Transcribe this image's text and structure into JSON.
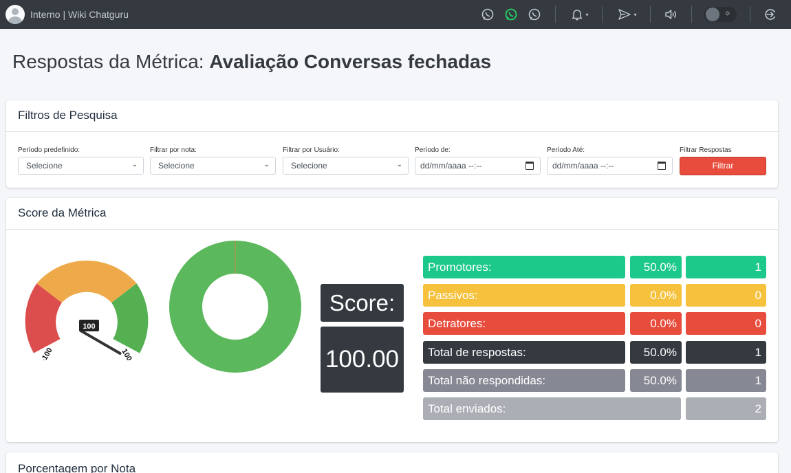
{
  "topbar": {
    "brand": "Interno | Wiki Chatguru",
    "icons": [
      "whatsapp-icon",
      "whatsapp-active-icon",
      "whatsapp-icon",
      "bell-icon",
      "send-icon",
      "volume-icon",
      "theme-toggle",
      "logout-icon"
    ],
    "caret": "▾",
    "sun": "☼"
  },
  "title": {
    "prefix": "Respostas da Métrica: ",
    "name": "Avaliação Conversas fechadas"
  },
  "filters": {
    "header": "Filtros de Pesquisa",
    "periodo_label": "Período predefinido:",
    "periodo_value": "Selecione",
    "nota_label": "Filtrar por nota:",
    "nota_value": "Selecione",
    "usuario_label": "Filtrar por Usuário:",
    "usuario_value": "Selecione",
    "de_label": "Período de:",
    "de_value": "dd/mm/aaaa --:--",
    "ate_label": "Período Até:",
    "ate_value": "dd/mm/aaaa --:--",
    "submit_label": "Filtrar Respostas",
    "submit_button": "Filtrar",
    "chevron": "⌄"
  },
  "score": {
    "header": "Score da Métrica",
    "gauge": {
      "min_label": "-100",
      "max_label": "100",
      "value_label": "100",
      "value": 100,
      "min": -100,
      "max": 100
    },
    "score_label": "Score:",
    "score_value": "100.00",
    "stats": [
      {
        "label": "Promotores:",
        "percent": "50.0%",
        "count": "1",
        "color": "#1dc98a"
      },
      {
        "label": "Passivos:",
        "percent": "0.0%",
        "count": "0",
        "color": "#f6c23e"
      },
      {
        "label": "Detratores:",
        "percent": "0.0%",
        "count": "0",
        "color": "#e74c3c"
      },
      {
        "label": "Total de respostas:",
        "percent": "50.0%",
        "count": "1",
        "color": "#343a40"
      },
      {
        "label": "Total não respondidas:",
        "percent": "50.0%",
        "count": "1",
        "color": "#868994"
      },
      {
        "label": "Total enviados:",
        "count": "2",
        "color": "#acaeb5"
      }
    ]
  },
  "chart_data": {
    "type": "pie",
    "categories": [
      "Promotores",
      "Passivos",
      "Detratores"
    ],
    "values": [
      1,
      0,
      0
    ],
    "colors": [
      "#5cb85c",
      "#f0ad4e",
      "#d9534f"
    ],
    "donut": true
  },
  "nota_card": {
    "header": "Porcentagem por Nota"
  },
  "colors": {
    "green": "#1dc98a",
    "yellow": "#f6c23e",
    "red": "#e74c3c",
    "dark": "#343a40"
  }
}
